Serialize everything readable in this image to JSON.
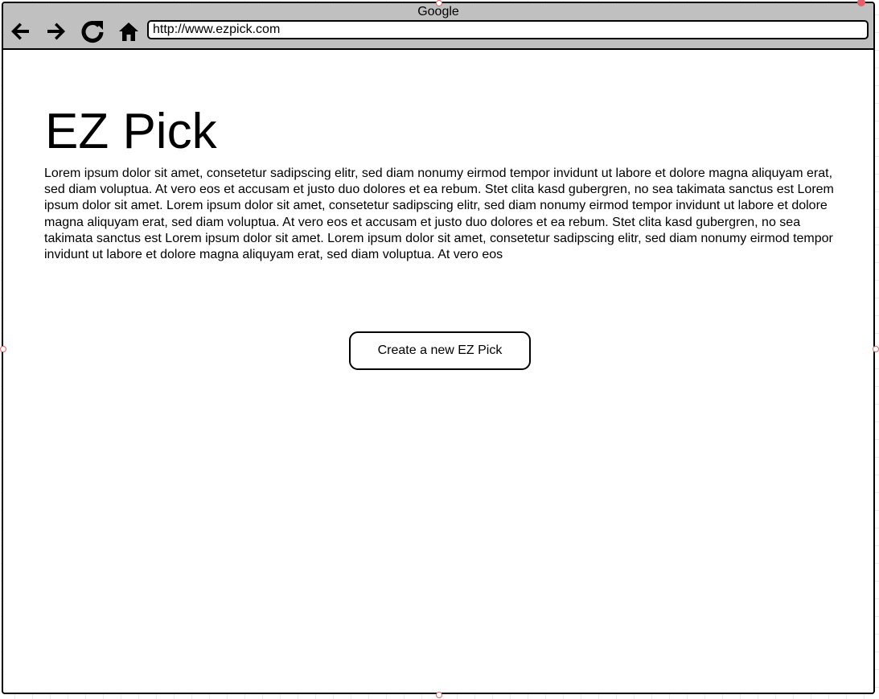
{
  "browser": {
    "title": "Google",
    "url": "http://www.ezpick.com",
    "nav_icons": [
      "back-arrow-icon",
      "forward-arrow-icon",
      "reload-icon",
      "home-icon"
    ]
  },
  "page": {
    "title": "EZ Pick",
    "body": "Lorem ipsum dolor sit amet, consetetur sadipscing elitr, sed diam nonumy eirmod tempor invidunt ut labore et dolore magna aliquyam erat, sed diam voluptua. At vero eos et accusam et justo duo dolores et ea rebum. Stet clita kasd gubergren, no sea takimata sanctus est Lorem ipsum dolor sit amet. Lorem ipsum dolor sit amet, consetetur sadipscing elitr, sed diam nonumy eirmod tempor invidunt ut labore et dolore magna aliquyam erat, sed diam voluptua. At vero eos et accusam et justo duo dolores et ea rebum. Stet clita kasd gubergren, no sea takimata sanctus est Lorem ipsum dolor sit amet. Lorem ipsum dolor sit amet, consetetur sadipscing elitr, sed diam nonumy eirmod tempor invidunt ut labore et dolore magna aliquyam erat, sed diam voluptua. At vero eos",
    "create_button_label": "Create a new EZ Pick"
  },
  "colors": {
    "chrome": "#c0c0c0",
    "selection_handle": "#e5606a"
  }
}
